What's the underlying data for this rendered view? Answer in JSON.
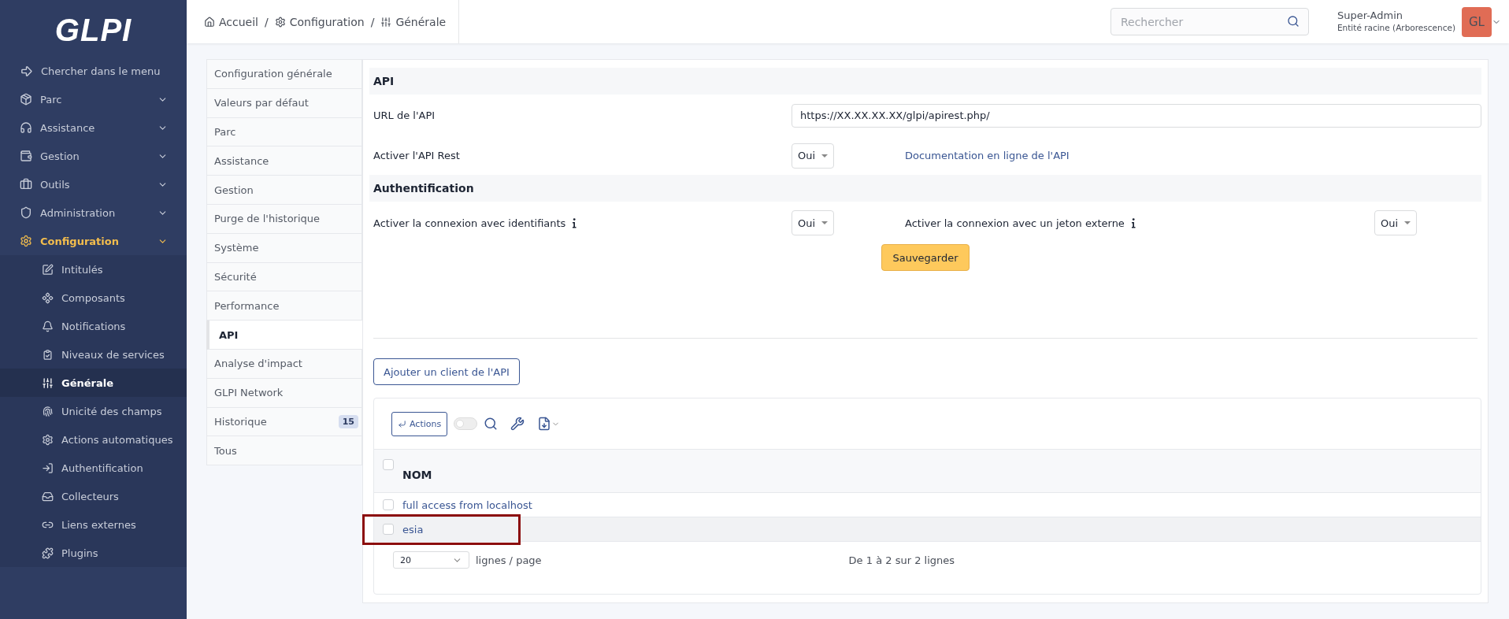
{
  "sidebar": {
    "logo": "GLPI",
    "search_item": "Chercher dans le menu",
    "items": [
      {
        "label": "Parc",
        "expanded": false,
        "selected": false
      },
      {
        "label": "Assistance",
        "expanded": false,
        "selected": false
      },
      {
        "label": "Gestion",
        "expanded": false,
        "selected": false
      },
      {
        "label": "Outils",
        "expanded": false,
        "selected": false
      },
      {
        "label": "Administration",
        "expanded": false,
        "selected": false
      },
      {
        "label": "Configuration",
        "expanded": true,
        "selected": true,
        "children": [
          {
            "label": "Intitulés",
            "selected": false
          },
          {
            "label": "Composants",
            "selected": false
          },
          {
            "label": "Notifications",
            "selected": false
          },
          {
            "label": "Niveaux de services",
            "selected": false
          },
          {
            "label": "Générale",
            "selected": true
          },
          {
            "label": "Unicité des champs",
            "selected": false
          },
          {
            "label": "Actions automatiques",
            "selected": false
          },
          {
            "label": "Authentification",
            "selected": false
          },
          {
            "label": "Collecteurs",
            "selected": false
          },
          {
            "label": "Liens externes",
            "selected": false
          },
          {
            "label": "Plugins",
            "selected": false
          }
        ]
      }
    ]
  },
  "breadcrumbs": [
    "Accueil",
    "Configuration",
    "Générale"
  ],
  "breadcrumb_separator": "/",
  "search": {
    "placeholder": "Rechercher"
  },
  "user": {
    "name": "Super-Admin",
    "entity": "Entité racine (Arborescence)",
    "initials": "GL"
  },
  "tabs": [
    {
      "label": "Configuration générale",
      "selected": false
    },
    {
      "label": "Valeurs par défaut",
      "selected": false
    },
    {
      "label": "Parc",
      "selected": false
    },
    {
      "label": "Assistance",
      "selected": false
    },
    {
      "label": "Gestion",
      "selected": false
    },
    {
      "label": "Purge de l'historique",
      "selected": false
    },
    {
      "label": "Système",
      "selected": false
    },
    {
      "label": "Sécurité",
      "selected": false
    },
    {
      "label": "Performance",
      "selected": false
    },
    {
      "label": "API",
      "selected": true
    },
    {
      "label": "Analyse d'impact",
      "selected": false
    },
    {
      "label": "GLPI Network",
      "selected": false
    },
    {
      "label": "Historique",
      "selected": false,
      "badge": "15"
    },
    {
      "label": "Tous",
      "selected": false
    }
  ],
  "api_section": {
    "title": "API",
    "url_label": "URL de l'API",
    "url_value": "https://XX.XX.XX.XX/glpi/apirest.php/",
    "rest_label": "Activer l'API Rest",
    "rest_value": "Oui",
    "doc_link": "Documentation en ligne de l'API"
  },
  "auth_section": {
    "title": "Authentification",
    "credentials_label": "Activer la connexion avec identifiants",
    "credentials_value": "Oui",
    "token_label": "Activer la connexion avec un jeton externe",
    "token_value": "Oui"
  },
  "save_button": "Sauvegarder",
  "add_client_button": "Ajouter un client de l'API",
  "table": {
    "actions_button": "Actions",
    "search_toggle": {
      "on": false
    },
    "select_all": {
      "checked": false
    },
    "columns": [
      "NOM"
    ],
    "rows": [
      {
        "name": "full access from localhost",
        "checked": false,
        "highlighted": false
      },
      {
        "name": "esia",
        "checked": false,
        "highlighted": true
      }
    ],
    "page_size": "20",
    "page_size_label": "lignes / page",
    "summary": "De 1 à 2 sur 2 lignes"
  }
}
